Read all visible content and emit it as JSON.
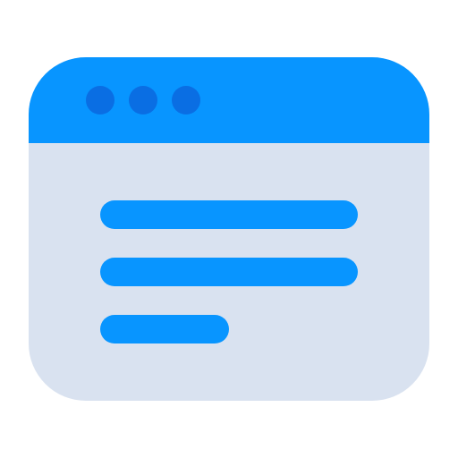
{
  "icon": {
    "name": "browser-window-icon",
    "colors": {
      "window_body": "#D9E2F0",
      "title_bar": "#0895FF",
      "dots": "#0A6EE3",
      "text_lines": "#0895FF",
      "background": "#FFFFFF"
    },
    "window_controls": [
      "dot-1",
      "dot-2",
      "dot-3"
    ],
    "content_lines": [
      "line-1",
      "line-2",
      "line-3"
    ]
  }
}
